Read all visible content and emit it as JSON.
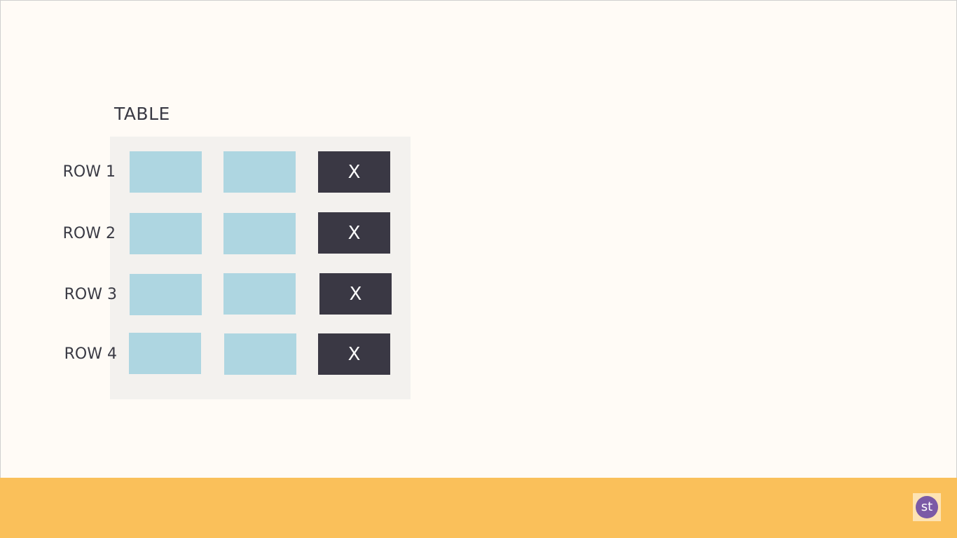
{
  "title": "TABLE",
  "rows": [
    {
      "label": "ROW 1",
      "action": "X"
    },
    {
      "label": "ROW 2",
      "action": "X"
    },
    {
      "label": "ROW 3",
      "action": "X"
    },
    {
      "label": "ROW 4",
      "action": "X"
    }
  ],
  "logo": {
    "text": "st"
  },
  "colors": {
    "background": "#fffbf6",
    "panel": "#f3f1ee",
    "cell": "#aed6e1",
    "action_cell": "#3a3844",
    "footer": "#fac05a",
    "logo_circle": "#7b5aa6"
  }
}
